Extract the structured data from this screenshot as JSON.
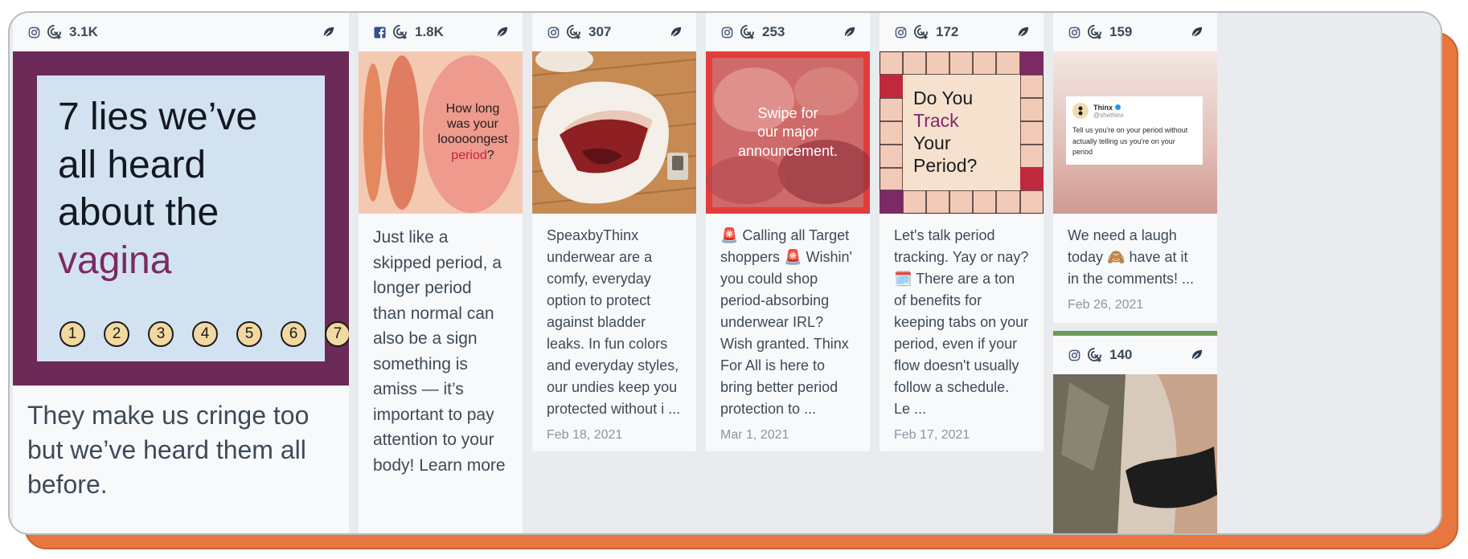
{
  "cards": [
    {
      "network": "instagram",
      "stat": "3.1K",
      "image": {
        "title_pre": "7 lies we’ve all heard about the ",
        "title_accent": "vagina",
        "numbers": [
          "1",
          "2",
          "3",
          "4",
          "5",
          "6",
          "7"
        ]
      },
      "text": "They make us cringe too but we’ve heard them all before."
    },
    {
      "network": "facebook",
      "stat": "1.8K",
      "image": {
        "line1": "How long",
        "line2": "was your",
        "line3": "looooongest",
        "accent": "period",
        "suffix": "?"
      },
      "text": "Just like a skipped period, a longer period than normal can also be a sign something is amiss — it’s important to pay attention to your body! Learn more"
    },
    {
      "network": "instagram",
      "stat": "307",
      "text": "SpeaxbyThinx underwear are a comfy, everyday option to protect against bladder leaks. In fun colors and everyday styles, our undies keep you protected without i ...",
      "date": "Feb 18, 2021"
    },
    {
      "network": "instagram",
      "stat": "253",
      "image": {
        "line1": "Swipe for",
        "line2": "our major",
        "line3": "announcement."
      },
      "text": "🚨 Calling all Target shoppers 🚨 Wishin' you could shop period-absorbing underwear IRL? Wish granted. Thinx For All is here to bring better period protection to ...",
      "date": "Mar 1, 2021"
    },
    {
      "network": "instagram",
      "stat": "172",
      "image": {
        "line1": "Do You",
        "accent": "Track",
        "line3": "Your",
        "line4": "Period?"
      },
      "text": "Let's talk period tracking. Yay or nay? 🗓️ There are a ton of benefits for keeping tabs on your period, even if your flow doesn't usually follow a schedule. Le ...",
      "date": "Feb 17, 2021"
    },
    {
      "network": "instagram",
      "stat": "159",
      "image": {
        "tweet_name": "Thinx",
        "tweet_handle": "@shethinx",
        "tweet_text": "Tell us you're on your period without actually telling us you're on your period"
      },
      "text": "We need a laugh today 🙈 have at it in the comments! ...",
      "date": "Feb 26, 2021"
    },
    {
      "network": "instagram",
      "stat": "140"
    }
  ],
  "colors": {
    "frame_bg": "#e9ebee",
    "shadow": "#e8773f",
    "accent_purple": "#7b2a64",
    "text": "#3d4a58",
    "date": "#8b95a1",
    "green_bar": "#6a9a55"
  }
}
